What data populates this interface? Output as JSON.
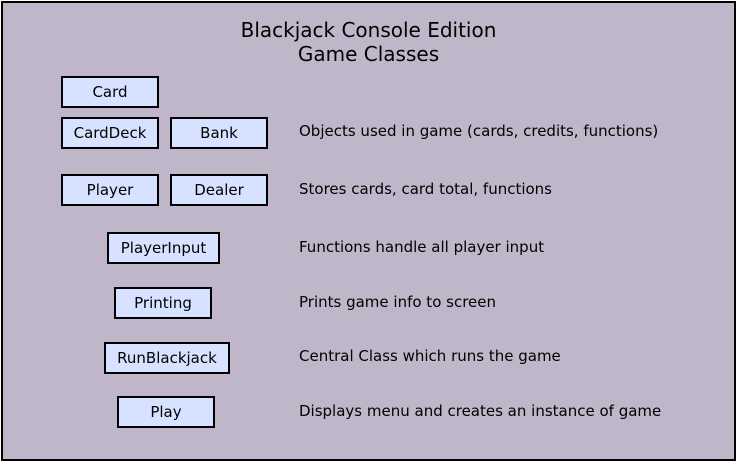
{
  "title": {
    "line1": "Blackjack Console Edition",
    "line2": "Game Classes"
  },
  "classes": [
    {
      "label": "Card"
    },
    {
      "label": "CardDeck"
    },
    {
      "label": "Bank"
    },
    {
      "label": "Player"
    },
    {
      "label": "Dealer"
    },
    {
      "label": "PlayerInput"
    },
    {
      "label": "Printing"
    },
    {
      "label": "RunBlackjack"
    },
    {
      "label": "Play"
    }
  ],
  "descriptions": [
    "Objects used in game (cards, credits, functions)",
    "Stores cards, card total, functions",
    "Functions handle all player input",
    "Prints game info to screen",
    "Central Class which runs the game",
    "Displays menu and creates an instance of game"
  ],
  "colors": {
    "background": "#bfb7c9",
    "box_fill": "#d6e2ff",
    "border": "#000000"
  }
}
